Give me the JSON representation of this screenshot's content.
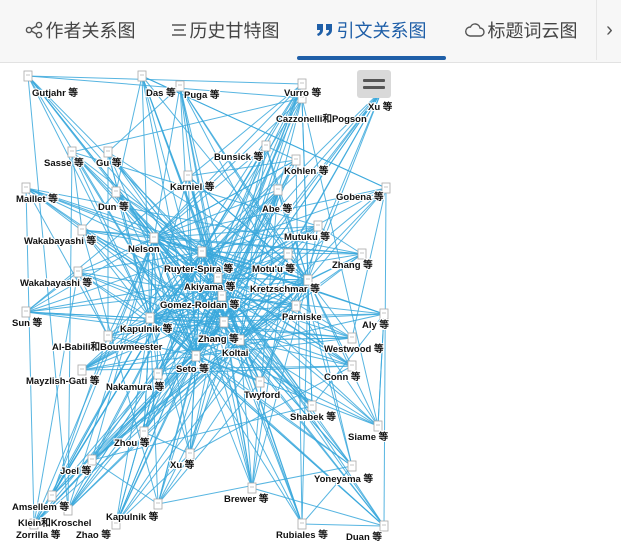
{
  "tabs": [
    {
      "label": "作者关系图",
      "icon": "share-nodes-icon",
      "active": false
    },
    {
      "label": "历史甘特图",
      "icon": "gantt-bars-icon",
      "active": false
    },
    {
      "label": "引文关系图",
      "icon": "quote-icon",
      "active": true
    },
    {
      "label": "标题词云图",
      "icon": "cloud-icon",
      "active": false
    }
  ],
  "tab_more_icon": "chevron-right-icon",
  "graph": {
    "menu_icon": "hamburger-menu-icon",
    "edge_color": "#3aa8dc",
    "node_color": "#c9c9c9",
    "labels": {
      "n1": "Gutjahr 等",
      "n2": "Das 等",
      "n3": "Puga 等",
      "n4": "Vurro 等",
      "n5": "Xu 等",
      "n6": "Cazzonelli和Pogson",
      "n7": "Sasse 等",
      "n8": "Gu 等",
      "n9": "Bunsick 等",
      "n10": "Kohlen 等",
      "n11": "Karniel 等",
      "n12": "Maillet 等",
      "n13": "Dun 等",
      "n14": "Abe 等",
      "n15": "Gobena 等",
      "n16": "Wakabayashi 等",
      "n17": "Nelson",
      "n18": "Mutuku 等",
      "n19": "Ruyter-Spira 等",
      "n20": "Motu'u 等",
      "n21": "Zhang 等",
      "n22": "Wakabayashi 等",
      "n23": "Akiyama 等",
      "n24": "Kretzschmar 等",
      "n25": "Gomez-Roldan 等",
      "n26": "Parniske",
      "n27": "Sun 等",
      "n28": "Aly 等",
      "n29": "Kapulnik 等",
      "n30": "Zhang 等",
      "n31": "Al-Babili和Bouwmeester",
      "n32": "Westwood 等",
      "n33": "Koltai",
      "n34": "Seto 等",
      "n35": "Mayzlish-Gati 等",
      "n36": "Conn 等",
      "n37": "Nakamura 等",
      "n38": "Twyford",
      "n39": "Shabek 等",
      "n40": "Zhou 等",
      "n41": "Siame 等",
      "n42": "Joel 等",
      "n43": "Xu 等",
      "n44": "Yoneyama 等",
      "n45": "Brewer 等",
      "n46": "Amsellem 等",
      "n47": "Kapulnik 等",
      "n48": "Klein和Kroschel",
      "n49": "Zorrilla 等",
      "n50": "Zhao 等",
      "n51": "Rubiales 等",
      "n52": "Duan 等"
    }
  }
}
